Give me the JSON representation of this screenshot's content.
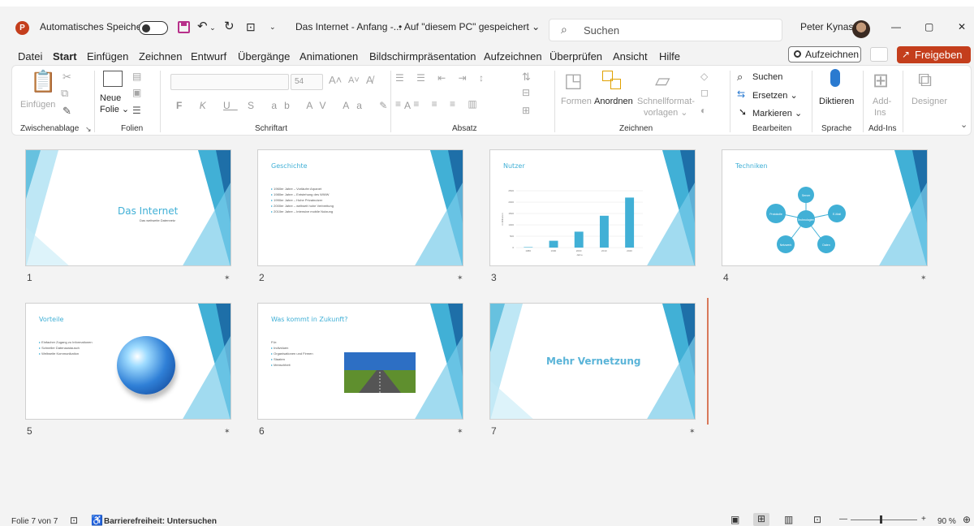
{
  "titlebar": {
    "autosave_label": "Automatisches Speichern",
    "doc_title": "Das Internet - Anfang -...",
    "save_status": "• Auf \"diesem PC\" gespeichert ⌄",
    "search_placeholder": "Suchen",
    "user_name": "Peter Kynast",
    "minimize": "—",
    "restore": "▢",
    "close": "✕"
  },
  "menu": {
    "tabs": [
      "Datei",
      "Start",
      "Einfügen",
      "Zeichnen",
      "Entwurf",
      "Übergänge",
      "Animationen",
      "Bildschirmpräsentation",
      "Aufzeichnen",
      "Überprüfen",
      "Ansicht",
      "Hilfe"
    ],
    "active_tab": "Start",
    "record_button": "Aufzeichnen",
    "share_button": "Freigeben"
  },
  "ribbon": {
    "clipboard": {
      "paste": "Einfügen",
      "label": "Zwischenablage"
    },
    "slides": {
      "new_slide_1": "Neue",
      "new_slide_2": "Folie ⌄",
      "label": "Folien"
    },
    "font": {
      "size": "54",
      "label": "Schriftart"
    },
    "paragraph": {
      "label": "Absatz"
    },
    "drawing": {
      "shapes": "Formen",
      "arrange": "Anordnen",
      "quick_styles_1": "Schnellformat-",
      "quick_styles_2": "vorlagen ⌄",
      "label": "Zeichnen"
    },
    "editing": {
      "find": "Suchen",
      "replace": "Ersetzen ⌄",
      "select": "Markieren ⌄",
      "label": "Bearbeiten"
    },
    "voice": {
      "dictate": "Diktieren",
      "label": "Sprache"
    },
    "addins": {
      "addins_1": "Add-",
      "addins_2": "Ins",
      "label": "Add-Ins"
    },
    "designer": {
      "label": "Designer"
    }
  },
  "slides": [
    {
      "number": "1",
      "title": "Das Internet",
      "subtitle": "Das weltweite Datennetz"
    },
    {
      "number": "2",
      "title": "Geschichte",
      "bullets": [
        "1960er Jahre – Vorläufer Arpanet",
        "1980er Jahre – Entstehung des WWW",
        "1990er Jahre – Hohe Privatnutzer",
        "2000er Jahre – weltweit hohe Verbreitung",
        "2010er Jahre – Intensive mobile Nutzung"
      ]
    },
    {
      "number": "3",
      "title": "Nutzer",
      "chart_yaxis": "in Millionen",
      "chart_xaxis": "Jahre"
    },
    {
      "number": "4",
      "title": "Techniken",
      "center": "Technologien",
      "nodes": [
        "Server",
        "Protokolle",
        "E-Mail",
        "Netzwerk",
        "Daten"
      ]
    },
    {
      "number": "5",
      "title": "Vorteile",
      "bullets": [
        "Einfacher Zugang zu Informationen",
        "Schneller Datenaustausch",
        "Weltweite Kommunikation"
      ]
    },
    {
      "number": "6",
      "title": "Was kommt in Zukunft?",
      "intro": "Für:",
      "bullets": [
        "Individuen",
        "Organisationen und Firmen",
        "Staaten",
        "Menschheit"
      ]
    },
    {
      "number": "7",
      "title": "Mehr Vernetzung"
    }
  ],
  "chart_data": {
    "type": "bar",
    "categories": [
      "1980",
      "1990",
      "2000",
      "2010",
      "2020"
    ],
    "values": [
      20,
      300,
      700,
      1400,
      2200
    ],
    "ylim": [
      0,
      2500
    ],
    "ylabel": "in Millionen",
    "xlabel": "Jahre"
  },
  "statusbar": {
    "slide_info": "Folie 7 von 7",
    "accessibility": "Barrierefreiheit: Untersuchen",
    "zoom": "90 %"
  },
  "colors": {
    "accent": "#c43e1c",
    "theme_blue": "#41b0d6"
  }
}
